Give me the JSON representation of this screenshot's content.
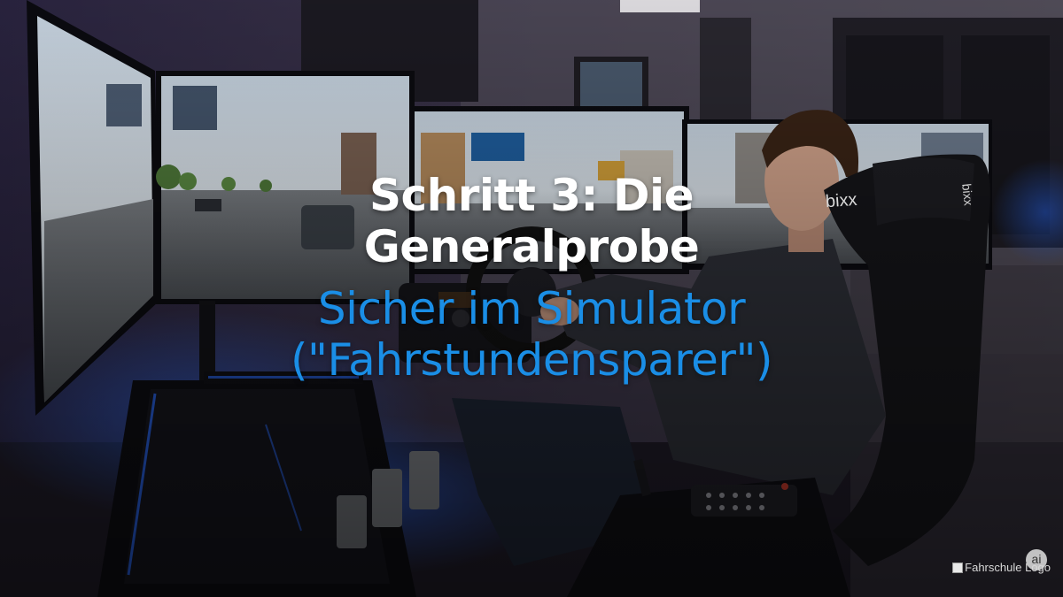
{
  "headline": {
    "title_line1": "Schritt 3: Die",
    "title_line2": "Generalprobe",
    "subtitle_line1": "Sicher im Simulator",
    "subtitle_line2": "(\"Fahrstundensparer\")"
  },
  "seat": {
    "brand_text": "bixx"
  },
  "logo": {
    "alt_text": "Fahrschule Logo",
    "ai_badge": "ai"
  },
  "colors": {
    "title": "#ffffff",
    "subtitle": "#1a8ee6",
    "ambient_blue": "#2b6cff"
  }
}
